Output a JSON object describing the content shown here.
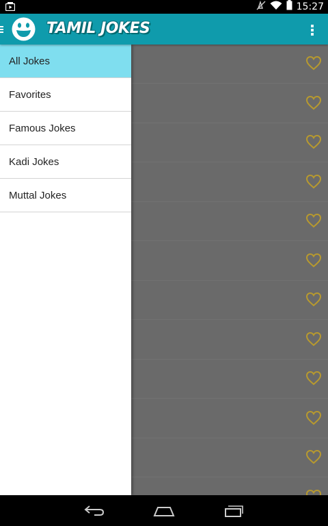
{
  "status_bar": {
    "time": "15:27",
    "icons": [
      "media-play-icon",
      "mute-icon",
      "wifi-icon",
      "battery-icon"
    ]
  },
  "app_bar": {
    "title": "TAMIL JOKES",
    "menu_icon": "hamburger-icon",
    "logo_icon": "smiley-icon",
    "overflow_icon": "more-vert-icon"
  },
  "drawer": {
    "items": [
      {
        "label": "All Jokes",
        "selected": true
      },
      {
        "label": "Favorites",
        "selected": false
      },
      {
        "label": "Famous Jokes",
        "selected": false
      },
      {
        "label": "Kadi Jokes",
        "selected": false
      },
      {
        "label": "Muttal Jokes",
        "selected": false
      }
    ]
  },
  "content": {
    "favorite_icon": "heart-outline-icon",
    "favorite_color": "#b89a2e"
  },
  "colors": {
    "app_bar": "#0f9bac",
    "selected_item": "#7fdeef",
    "scrim_content": "#6a6a6a"
  },
  "nav_bar": {
    "buttons": [
      "back-icon",
      "home-icon",
      "recents-icon"
    ]
  }
}
